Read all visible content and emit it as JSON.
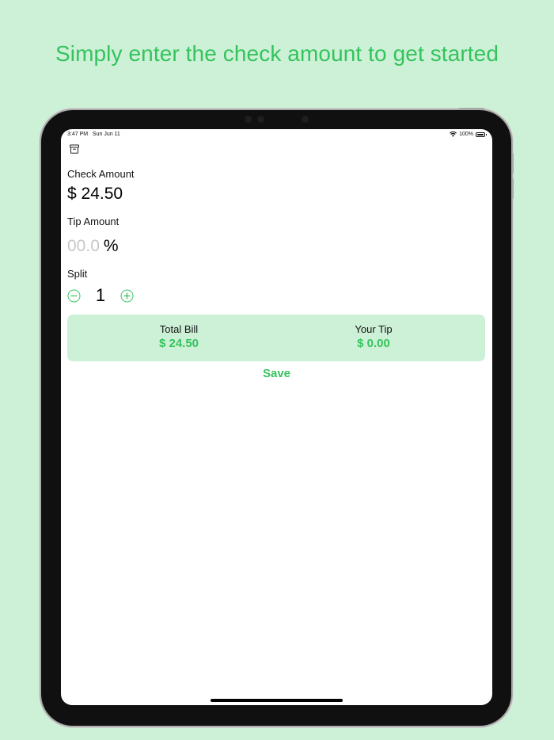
{
  "headline": "Simply enter the check amount to get started",
  "status_bar": {
    "time": "3:47 PM",
    "date": "Sun Jun 11",
    "battery": "100%",
    "battery_level": 1.0
  },
  "toolbar": {
    "archive_icon": "archive-box-icon"
  },
  "check_amount": {
    "label": "Check Amount",
    "value": "$ 24.50"
  },
  "tip_amount": {
    "label": "Tip Amount",
    "placeholder": "00.0",
    "value": "",
    "unit": "%"
  },
  "split": {
    "label": "Split",
    "value": "1",
    "decrement_icon": "minus-circle-icon",
    "increment_icon": "plus-circle-icon"
  },
  "summary": {
    "total_bill_label": "Total Bill",
    "total_bill_value": "$ 24.50",
    "your_tip_label": "Your Tip",
    "your_tip_value": "$ 0.00"
  },
  "actions": {
    "save_label": "Save"
  },
  "colors": {
    "accent": "#35c35d",
    "background": "#cdf1d7",
    "placeholder": "#c7c7c7"
  }
}
